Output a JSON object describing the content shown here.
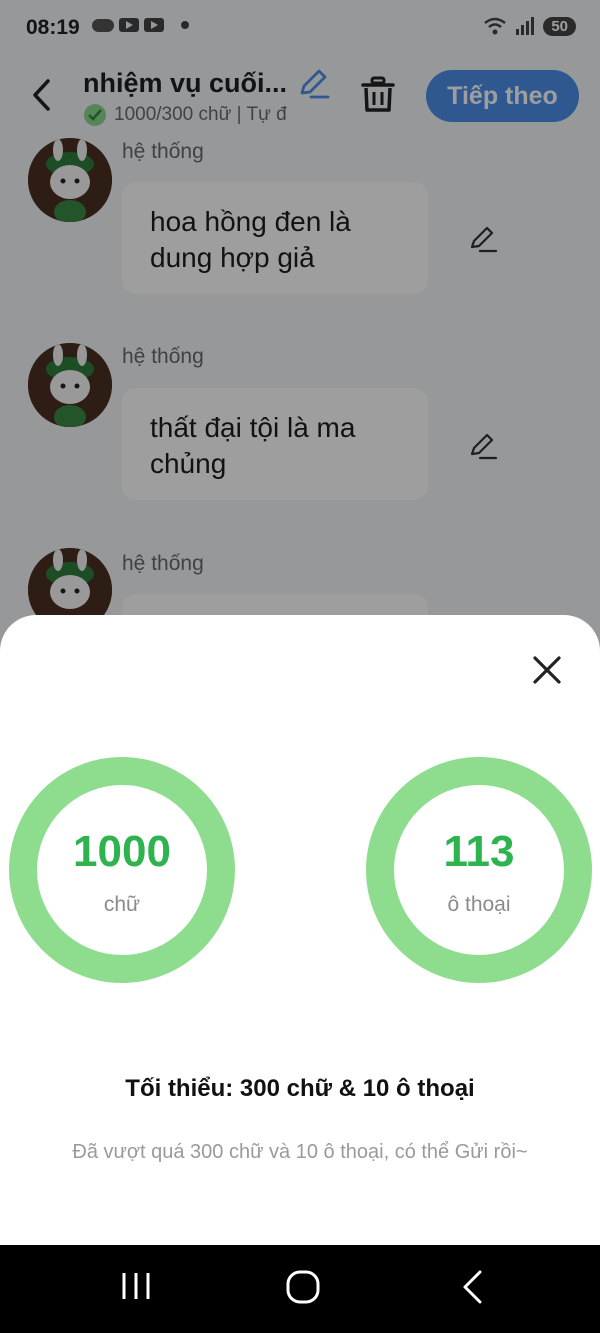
{
  "status_bar": {
    "time": "08:19",
    "battery": "50",
    "icons": [
      "cloud-icon",
      "youtube-icon",
      "youtube-icon",
      "dot-icon",
      "wifi-icon",
      "signal-icon",
      "battery-icon"
    ]
  },
  "header": {
    "title": "nhiệm vụ cuối...",
    "subtitle": "1000/300 chữ | Tự đ",
    "next_label": "Tiếp theo",
    "accent": "#4d8fe8"
  },
  "messages": [
    {
      "sender": "hệ thống",
      "text": "hoa hồng đen là dung hợp giả"
    },
    {
      "sender": "hệ thống",
      "text": "thất đại tội là ma chủng"
    },
    {
      "sender": "hệ thống",
      "text": ""
    }
  ],
  "sheet": {
    "stats": [
      {
        "value": "1000",
        "unit": "chữ"
      },
      {
        "value": "113",
        "unit": "ô thoại"
      }
    ],
    "minimum_text": "Tối thiểu: 300 chữ & 10 ô thoại",
    "note_text": "Đã vượt quá 300 chữ và 10 ô thoại, có thể Gửi rồi~",
    "ring_color": "#8edd8e",
    "value_color": "#2eb34f"
  },
  "nav": {
    "icons": [
      "recent-apps-icon",
      "home-icon",
      "back-nav-icon"
    ]
  }
}
